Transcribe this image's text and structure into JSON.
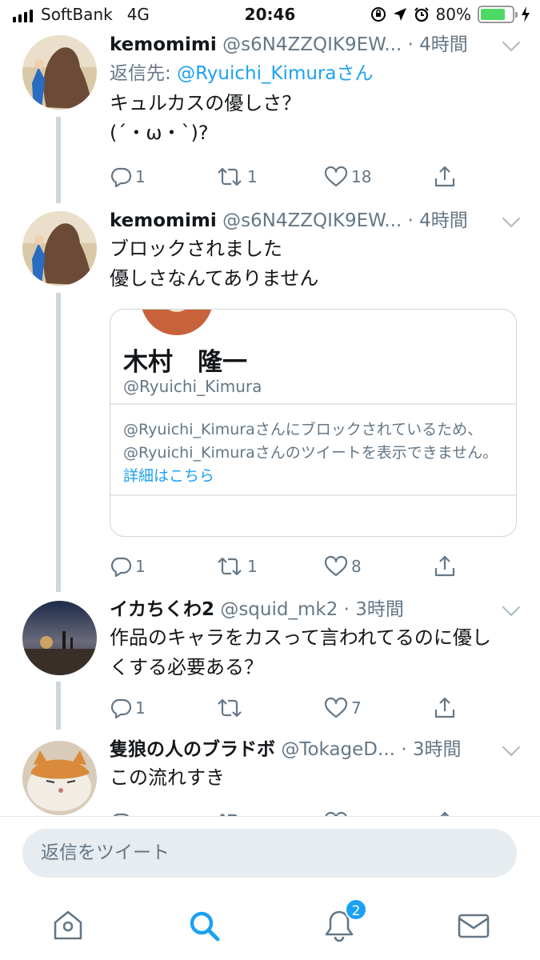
{
  "status_bar": {
    "carrier": "SoftBank",
    "network": "4G",
    "time": "20:46",
    "battery": "80%",
    "battery_level": 0.8
  },
  "tweets": [
    {
      "name": "kemomimi",
      "handle": "@s6N4ZZQIK9EW...",
      "time": "· 4時間",
      "reply_prefix": "返信先:",
      "reply_to": "@Ryuichi_Kimuraさん",
      "text_lines": [
        "キュルカスの優しさ？",
        "(´・ω・`)?"
      ],
      "replies": "1",
      "retweets": "1",
      "likes": "18"
    },
    {
      "name": "kemomimi",
      "handle": "@s6N4ZZQIK9EW...",
      "time": "· 4時間",
      "text_lines": [
        "ブロックされました",
        "優しさなんてありません"
      ],
      "quote": {
        "name": "木村　隆一",
        "handle": "@Ryuichi_Kimura",
        "message_lines": [
          "@Ryuichi_Kimuraさんにブロックされているため、",
          "@Ryuichi_Kimuraさんのツイートを表示できません。"
        ],
        "more_link": "詳細はこちら"
      },
      "replies": "1",
      "retweets": "1",
      "likes": "8"
    },
    {
      "name": "イカちくわ2",
      "handle": "@squid_mk2",
      "time": "· 3時間",
      "text_lines": [
        "作品のキャラをカスって言われてるのに優し",
        "くする必要ある？"
      ],
      "replies": "1",
      "retweets": "",
      "likes": "7"
    },
    {
      "name": "隻狼の人のブラドボ",
      "handle": "@TokageD...",
      "time": "· 3時間",
      "text_lines": [
        "この流れすき"
      ]
    }
  ],
  "compose": {
    "placeholder": "返信をツイート"
  },
  "tab_bar": {
    "notifications_badge": "2",
    "icons": [
      "home-icon",
      "search-icon",
      "notifications-icon",
      "messages-icon"
    ],
    "accent_color": "#1da1f2"
  }
}
